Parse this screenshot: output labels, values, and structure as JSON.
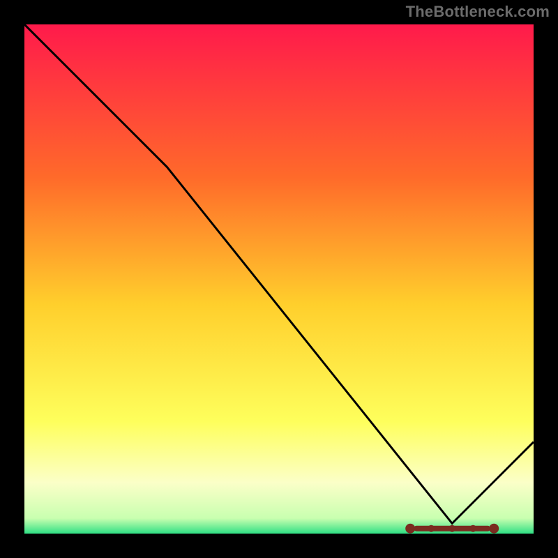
{
  "attribution": "TheBottleneck.com",
  "colors": {
    "bg": "#000000",
    "gradient_top": "#ff1a4b",
    "gradient_mid_upper": "#ff6a2a",
    "gradient_mid": "#ffcf2c",
    "gradient_mid_lower": "#feff5c",
    "gradient_pale": "#fbffc8",
    "gradient_green": "#2fe084",
    "curve": "#000000",
    "feet": "#7a2b20",
    "attribution_text": "#6b6b6b"
  },
  "chart_data": {
    "type": "line",
    "title": "",
    "xlabel": "",
    "ylabel": "",
    "xlim": [
      0,
      100
    ],
    "ylim": [
      0,
      100
    ],
    "grid": false,
    "legend_position": "none",
    "series": [
      {
        "name": "bottleneck-curve",
        "x": [
          0,
          10,
          20,
          28,
          40,
          52,
          64,
          76,
          84,
          92,
          100
        ],
        "values": [
          100,
          90,
          80,
          72,
          57,
          42,
          27,
          12,
          2,
          10,
          18
        ]
      }
    ],
    "annotations": [
      {
        "name": "min-marker",
        "x": 84,
        "y": 1
      }
    ],
    "background_gradient_stops": [
      {
        "offset": 0.0,
        "color": "#ff1a4b"
      },
      {
        "offset": 0.3,
        "color": "#ff6a2a"
      },
      {
        "offset": 0.55,
        "color": "#ffcf2c"
      },
      {
        "offset": 0.78,
        "color": "#feff5c"
      },
      {
        "offset": 0.9,
        "color": "#fbffc8"
      },
      {
        "offset": 0.97,
        "color": "#c9ffb0"
      },
      {
        "offset": 1.0,
        "color": "#2fe084"
      }
    ]
  }
}
